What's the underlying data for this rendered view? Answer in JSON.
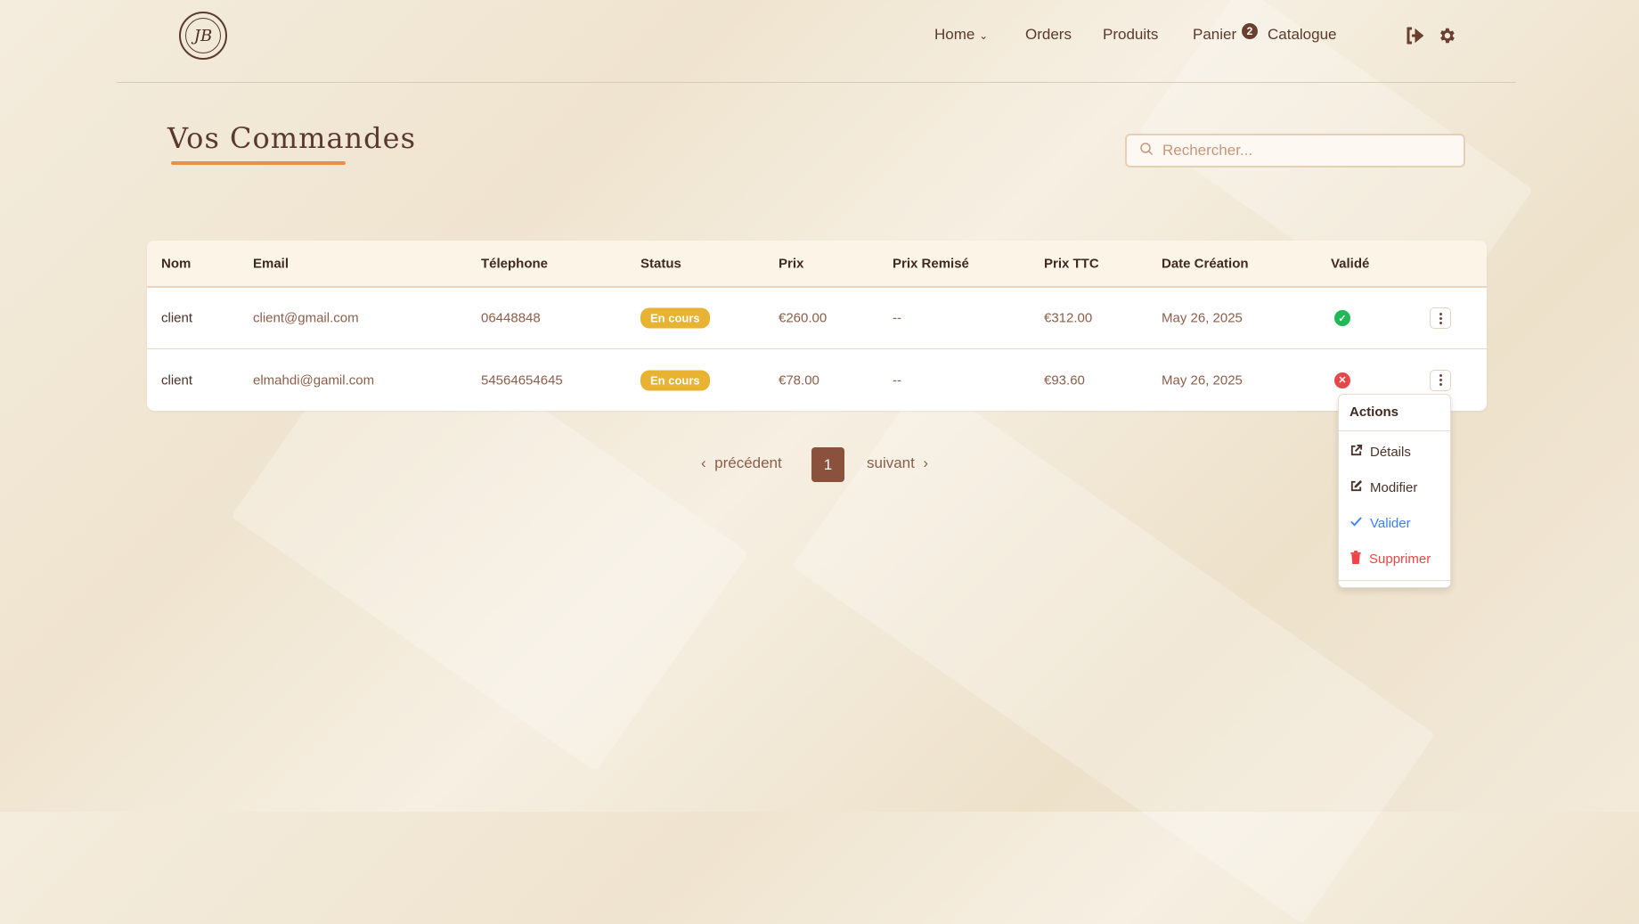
{
  "header": {
    "logo_text": "JB",
    "nav": [
      {
        "label": "Home"
      },
      {
        "label": "Orders"
      },
      {
        "label": "Produits"
      },
      {
        "label": "Panier"
      },
      {
        "label": "Catalogue"
      }
    ],
    "cart_count": "2"
  },
  "page": {
    "title": "Vos Commandes",
    "search_placeholder": "Rechercher..."
  },
  "table": {
    "headers": [
      "Nom",
      "Email",
      "Télephone",
      "Status",
      "Prix",
      "Prix Remisé",
      "Prix TTC",
      "Date Création",
      "Validé"
    ],
    "rows": [
      {
        "nom": "client",
        "email": "client@gmail.com",
        "telephone": "06448848",
        "status": "En cours",
        "prix": "€260.00",
        "prix_remise": "--",
        "prix_ttc": "€312.00",
        "date": "May 26, 2025",
        "valide": true
      },
      {
        "nom": "client",
        "email": "elmahdi@gamil.com",
        "telephone": "54564654645",
        "status": "En cours",
        "prix": "€78.00",
        "prix_remise": "--",
        "prix_ttc": "€93.60",
        "date": "May 26, 2025",
        "valide": false
      }
    ]
  },
  "actions_menu": {
    "title": "Actions",
    "items": [
      {
        "label": "Détails",
        "color": "#4a3228"
      },
      {
        "label": "Modifier",
        "color": "#4a3228"
      },
      {
        "label": "Valider",
        "color": "#3b82f6"
      },
      {
        "label": "Supprimer",
        "color": "#ef4444"
      }
    ]
  },
  "pagination": {
    "prev": "précédent",
    "current": "1",
    "next": "suivant"
  },
  "colors": {
    "accent": "#ec8f45",
    "brown": "#8a523c",
    "status": "#e8b233"
  }
}
